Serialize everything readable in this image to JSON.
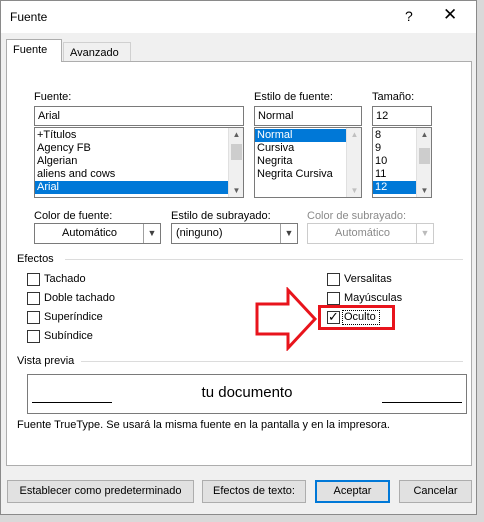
{
  "window": {
    "title": "Fuente",
    "help_glyph": "?",
    "close_glyph": "✕"
  },
  "tabs": [
    {
      "label": "Fuente",
      "active": true
    },
    {
      "label": "Avanzado",
      "active": false
    }
  ],
  "font": {
    "label": "Fuente:",
    "value": "Arial",
    "items": [
      "+Títulos",
      "Agency FB",
      "Algerian",
      "aliens and cows",
      "Arial"
    ],
    "selected": "Arial"
  },
  "style": {
    "label": "Estilo de fuente:",
    "value": "Normal",
    "items": [
      "Normal",
      "Cursiva",
      "Negrita",
      "Negrita Cursiva"
    ],
    "selected": "Normal"
  },
  "size": {
    "label": "Tamaño:",
    "value": "12",
    "items": [
      "8",
      "9",
      "10",
      "11",
      "12"
    ],
    "selected": "12"
  },
  "font_color": {
    "label": "Color de fuente:",
    "value": "Automático"
  },
  "underline_style": {
    "label": "Estilo de subrayado:",
    "value": "(ninguno)"
  },
  "underline_color": {
    "label": "Color de subrayado:",
    "value": "Automático",
    "disabled": true
  },
  "effects": {
    "title": "Efectos",
    "left": [
      {
        "label": "Tachado",
        "checked": false
      },
      {
        "label": "Doble tachado",
        "checked": false
      },
      {
        "label": "Superíndice",
        "checked": false
      },
      {
        "label": "Subíndice",
        "checked": false
      }
    ],
    "right": [
      {
        "label": "Versalitas",
        "checked": false
      },
      {
        "label": "Mayúsculas",
        "checked": false
      },
      {
        "label": "Oculto",
        "checked": true
      }
    ]
  },
  "preview": {
    "title": "Vista previa",
    "sample": "tu documento",
    "note": "Fuente TrueType. Se usará la misma fuente en la pantalla y en la impresora."
  },
  "buttons": {
    "default_btn": "Establecer como predeterminado",
    "text_effects": "Efectos de texto:",
    "ok": "Aceptar",
    "cancel": "Cancelar"
  },
  "glyphs": {
    "check": "✓",
    "arrow_down": "▼",
    "arrow_up": "▲"
  },
  "colors": {
    "selection": "#0078d7",
    "annotation": "#e8141c",
    "accent_border": "#0078d7"
  }
}
